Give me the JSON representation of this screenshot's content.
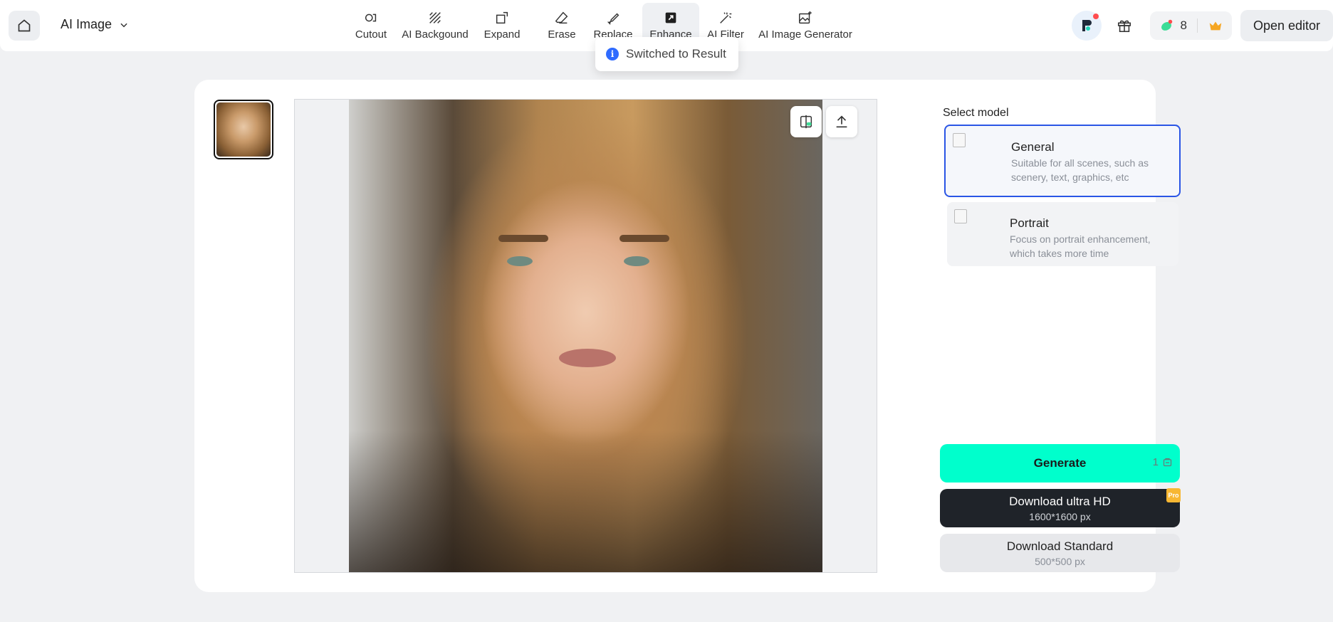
{
  "header": {
    "app_switch_label": "AI Image",
    "tools": [
      {
        "label": "Cutout",
        "icon": "cutout-icon"
      },
      {
        "label": "AI Backgound",
        "icon": "ai-background-icon"
      },
      {
        "label": "Expand",
        "icon": "expand-icon"
      },
      {
        "label": "Erase",
        "icon": "erase-icon"
      },
      {
        "label": "Replace",
        "icon": "replace-icon"
      },
      {
        "label": "Enhance",
        "icon": "enhance-icon",
        "active": true
      },
      {
        "label": "AI Filter",
        "icon": "magic-wand-icon"
      },
      {
        "label": "AI Image Generator",
        "icon": "image-generator-icon"
      }
    ],
    "credits": "8",
    "open_editor_label": "Open editor"
  },
  "toast": {
    "message": "Switched to Result"
  },
  "panel": {
    "title": "Select model",
    "models": [
      {
        "name": "General",
        "description": "Suitable for all scenes, such as scenery, text, graphics, etc",
        "selected": true
      },
      {
        "name": "Portrait",
        "description": "Focus on portrait enhancement, which takes more time",
        "selected": false
      }
    ],
    "generate_label": "Generate",
    "generate_cost": "1",
    "download_hd": {
      "title": "Download ultra HD",
      "size": "1600*1600 px",
      "badge": "Pro"
    },
    "download_standard": {
      "title": "Download Standard",
      "size": "500*500 px"
    }
  },
  "colors": {
    "accent": "#00ffcc",
    "selected_border": "#2a55e5",
    "dark_button": "#1f2329",
    "pro_badge": "#f7b733"
  }
}
